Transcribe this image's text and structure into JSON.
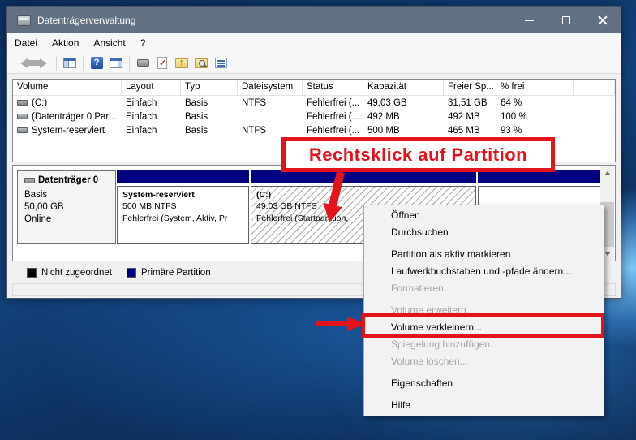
{
  "window": {
    "title": "Datenträgerverwaltung",
    "title_icon": "disk-drive-icon",
    "controls": [
      "minimize-icon",
      "maximize-icon",
      "close-icon"
    ],
    "menus": {
      "datei": "Datei",
      "aktion": "Aktion",
      "ansicht": "Ansicht",
      "hilfe": "?"
    }
  },
  "toolbar": {
    "icons": [
      "back-arrow-icon",
      "forward-arrow-icon",
      "console-tree-icon",
      "help-icon",
      "action-pane-icon",
      "device-icon",
      "refresh-check-icon",
      "folder-up-icon",
      "folder-search-icon",
      "checklist-icon"
    ]
  },
  "volume_table": {
    "columns": {
      "volume": "Volume",
      "layout": "Layout",
      "typ": "Typ",
      "dateisystem": "Dateisystem",
      "status": "Status",
      "kapazitaet": "Kapazität",
      "freier_sp": "Freier Sp...",
      "pct_frei": "% frei"
    },
    "rows": [
      {
        "volume": "(C:)",
        "layout": "Einfach",
        "typ": "Basis",
        "dateisystem": "NTFS",
        "status": "Fehlerfrei (...",
        "kapazitaet": "49,03 GB",
        "freier_sp": "31,51 GB",
        "pct_frei": "64 %"
      },
      {
        "volume": "(Datenträger 0 Par...",
        "layout": "Einfach",
        "typ": "Basis",
        "dateisystem": "",
        "status": "Fehlerfrei (...",
        "kapazitaet": "492 MB",
        "freier_sp": "492 MB",
        "pct_frei": "100 %"
      },
      {
        "volume": "System-reserviert",
        "layout": "Einfach",
        "typ": "Basis",
        "dateisystem": "NTFS",
        "status": "Fehlerfrei (...",
        "kapazitaet": "500 MB",
        "freier_sp": "465 MB",
        "pct_frei": "93 %"
      }
    ]
  },
  "disk": {
    "name": "Datenträger 0",
    "type": "Basis",
    "size": "50,00 GB",
    "state": "Online",
    "partitions": [
      {
        "name": "System-reserviert",
        "info": "500 MB NTFS",
        "status": "Fehlerfrei (System, Aktiv, Pr"
      },
      {
        "name": "(C:)",
        "info": "49,03 GB NTFS",
        "status": "Fehlerfrei (Startpartition,"
      },
      {
        "name": "",
        "info": "",
        "status": ""
      }
    ],
    "band_color": "#000080"
  },
  "legend": [
    {
      "label": "Nicht zugeordnet",
      "color": "#000000"
    },
    {
      "label": "Primäre Partition",
      "color": "#000080"
    }
  ],
  "context_menu": {
    "items": [
      {
        "label": "Öffnen",
        "enabled": true
      },
      {
        "label": "Durchsuchen",
        "enabled": true
      },
      {
        "label": "Partition als aktiv markieren",
        "enabled": true
      },
      {
        "label": "Laufwerkbuchstaben und -pfade ändern...",
        "enabled": true
      },
      {
        "label": "Formatieren...",
        "enabled": false
      },
      {
        "label": "Volume erweitern...",
        "enabled": false
      },
      {
        "label": "Volume verkleinern...",
        "enabled": true
      },
      {
        "label": "Spiegelung hinzufügen...",
        "enabled": false
      },
      {
        "label": "Volume löschen...",
        "enabled": false
      },
      {
        "label": "Eigenschaften",
        "enabled": true
      },
      {
        "label": "Hilfe",
        "enabled": true
      }
    ]
  },
  "annotations": {
    "callout_text": "Rechtsklick auf Partition",
    "highlight_color": "#e2131b",
    "highlighted_item": "Volume verkleinern..."
  }
}
